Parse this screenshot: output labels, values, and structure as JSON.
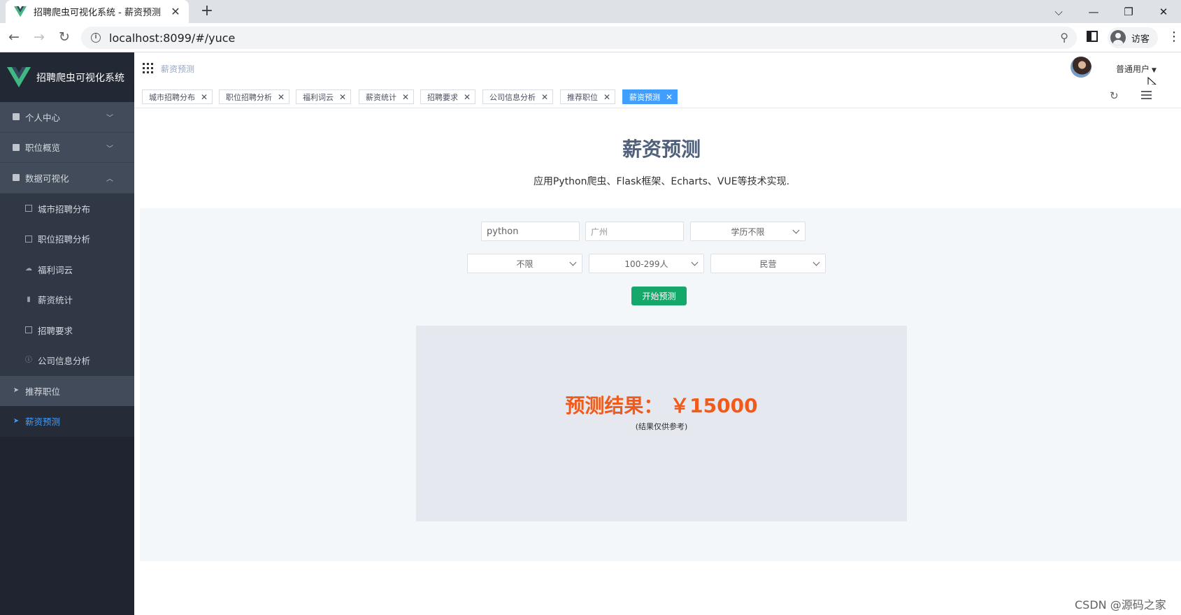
{
  "browser": {
    "tab_title": "招聘爬虫可视化系统 - 薪资预测",
    "url": "localhost:8099/#/yuce",
    "profile_label": "访客",
    "new_tab": "+",
    "tab_close": "✕"
  },
  "sidebar": {
    "brand": "招聘爬虫可视化系统",
    "items": [
      {
        "label": "个人中心",
        "icon": "document-icon",
        "expanded": false
      },
      {
        "label": "职位概览",
        "icon": "document-icon",
        "expanded": false
      },
      {
        "label": "数据可视化",
        "icon": "document-icon",
        "expanded": true
      },
      {
        "label": "城市招聘分布",
        "icon": "table-icon"
      },
      {
        "label": "职位招聘分析",
        "icon": "table-icon"
      },
      {
        "label": "福利词云",
        "icon": "cloud-icon"
      },
      {
        "label": "薪资统计",
        "icon": "bar-chart-icon"
      },
      {
        "label": "招聘要求",
        "icon": "list-icon"
      },
      {
        "label": "公司信息分析",
        "icon": "info-icon"
      },
      {
        "label": "推荐职位",
        "icon": "send-icon"
      },
      {
        "label": "薪资预测",
        "icon": "send-icon",
        "active": true
      }
    ]
  },
  "header": {
    "breadcrumb": "薪资预测",
    "user_role": "普通用户"
  },
  "tags": [
    {
      "label": "城市招聘分布"
    },
    {
      "label": "职位招聘分析"
    },
    {
      "label": "福利词云"
    },
    {
      "label": "薪资统计"
    },
    {
      "label": "招聘要求"
    },
    {
      "label": "公司信息分析"
    },
    {
      "label": "推荐职位"
    },
    {
      "label": "薪资预测",
      "active": true
    }
  ],
  "main": {
    "title": "薪资预测",
    "subtitle": "应用Python爬虫、Flask框架、Echarts、VUE等技术实现.",
    "form": {
      "keyword_value": "python",
      "city_placeholder": "广州",
      "education_value": "学历不限",
      "experience_value": "不限",
      "company_size_value": "100-299人",
      "company_type_value": "民营",
      "submit_label": "开始预测"
    },
    "result": {
      "label": "预测结果： ￥15000",
      "note": "(结果仅供参考)"
    }
  },
  "watermark": "CSDN @源码之家",
  "colors": {
    "sidebar_bg": "#1f2430",
    "accent_blue": "#409eff",
    "submit_green": "#16a86b",
    "result_orange": "#f05b1c"
  }
}
